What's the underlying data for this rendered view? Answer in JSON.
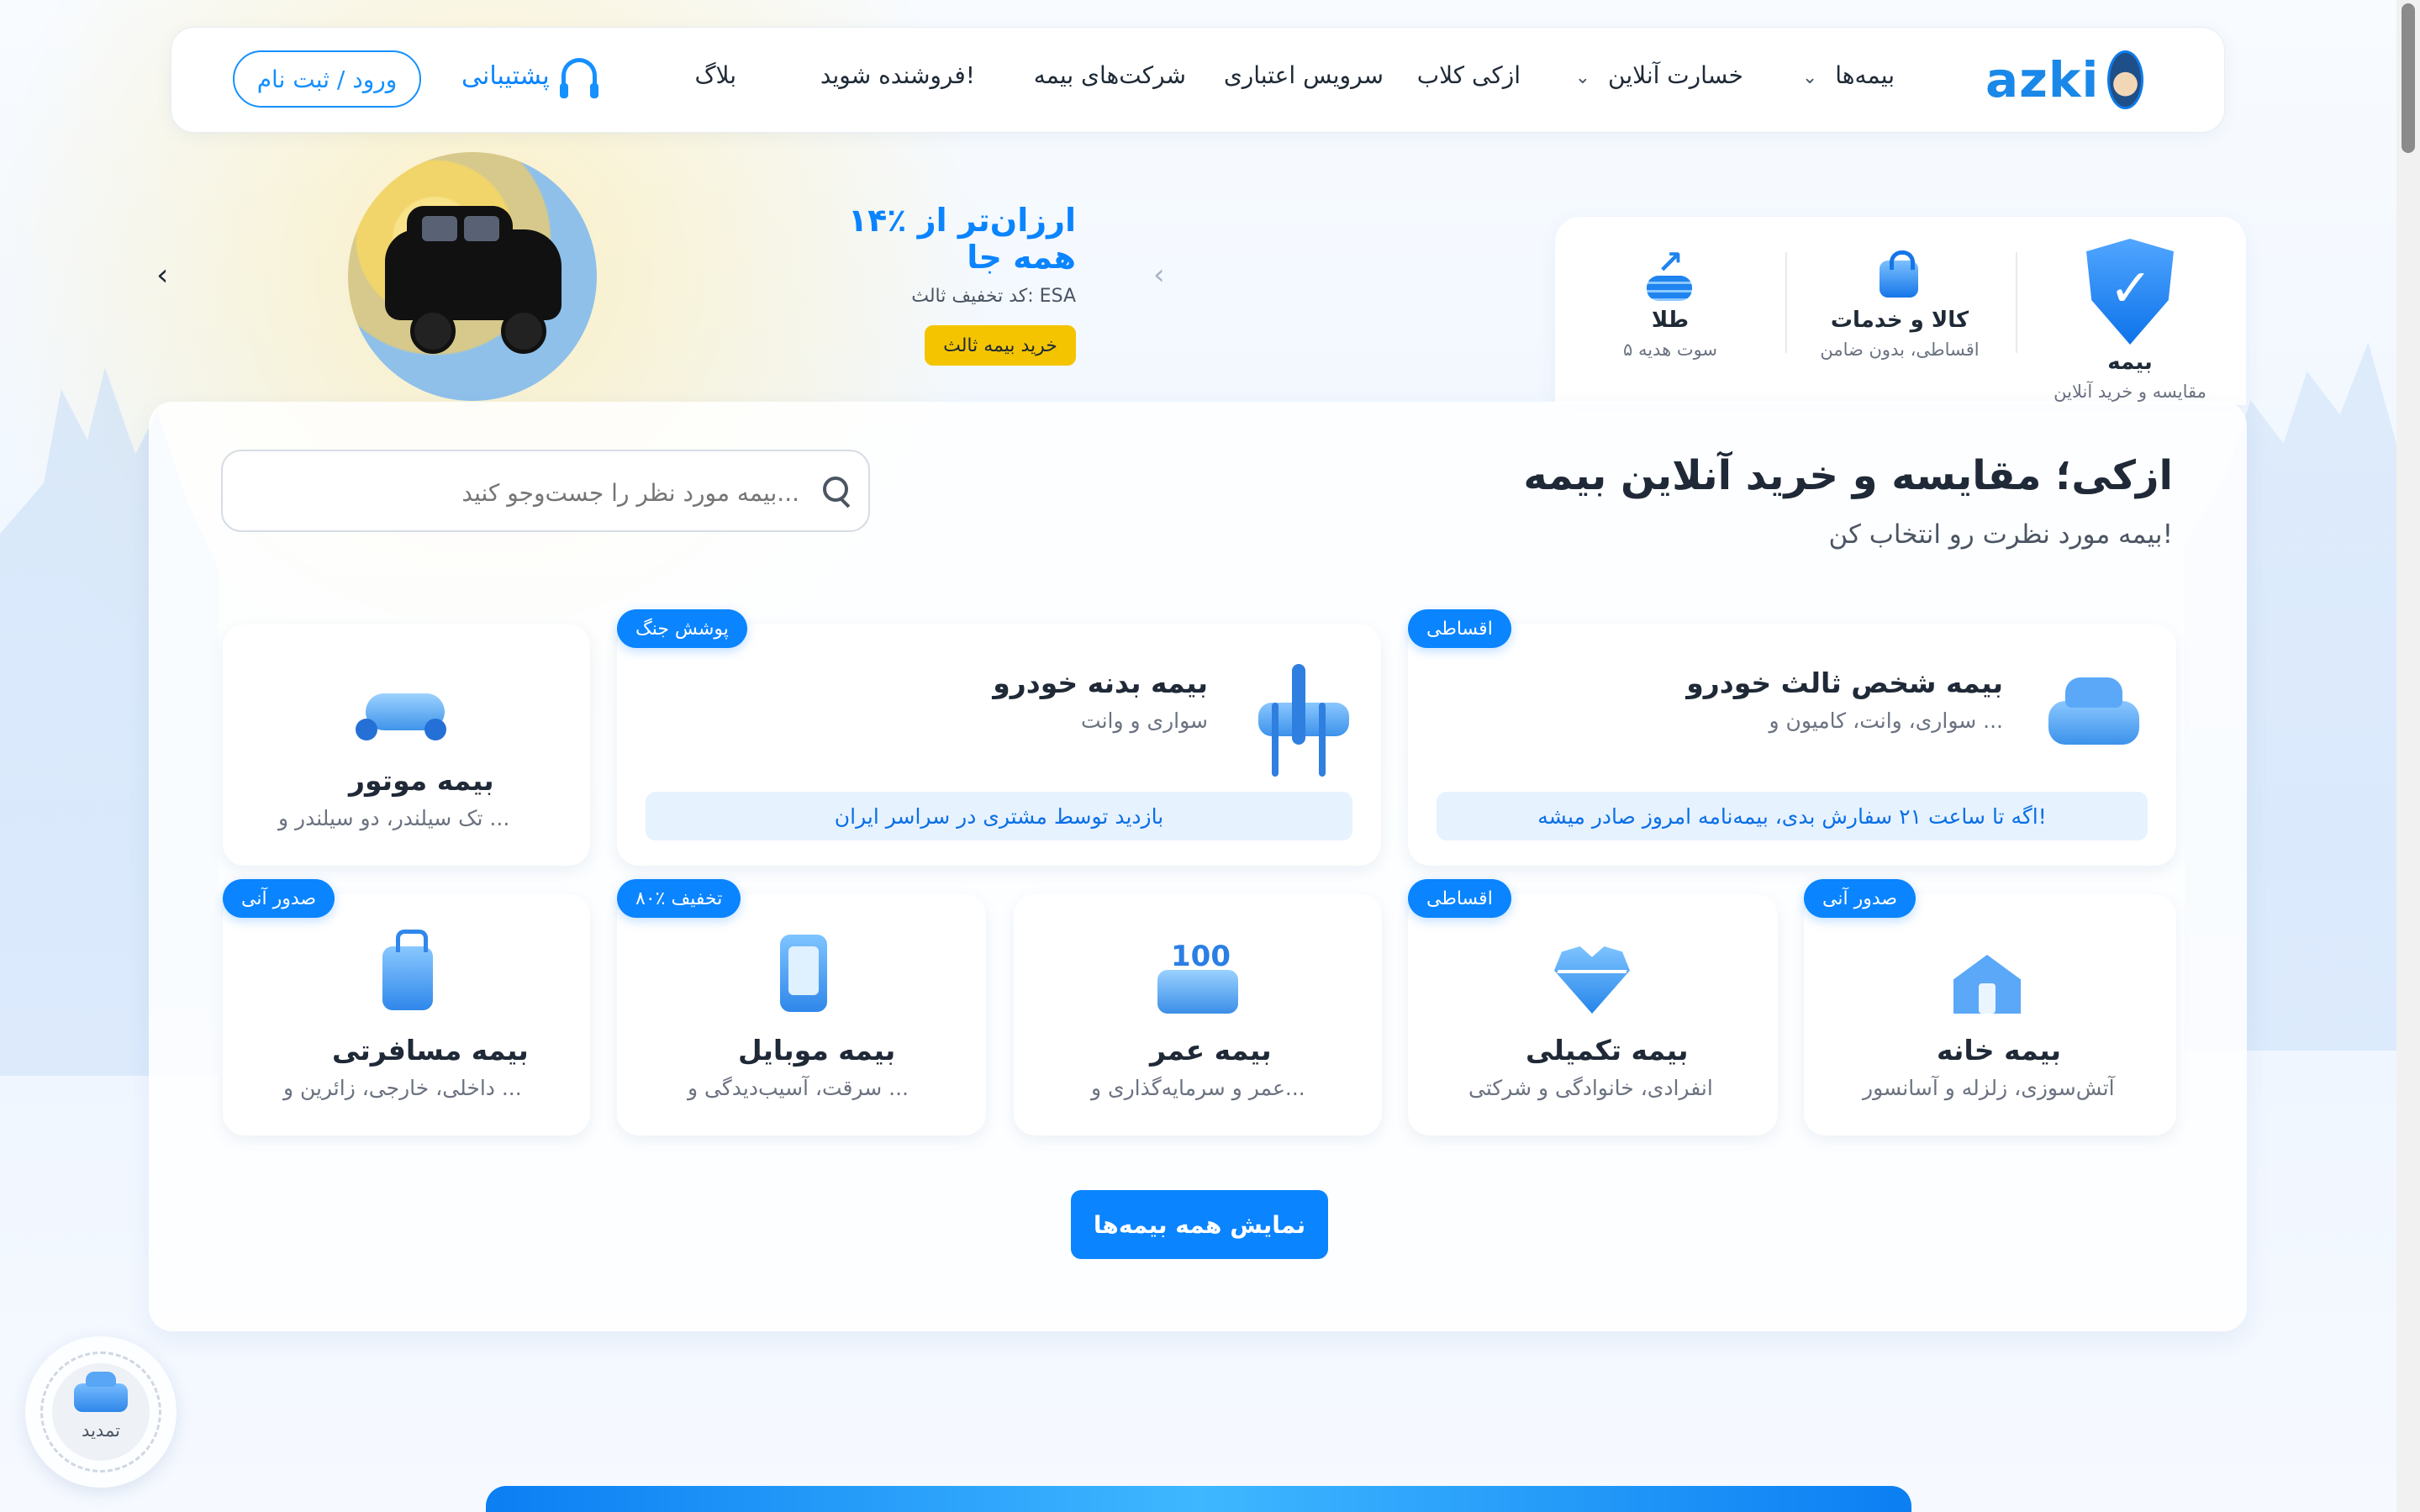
{
  "navbar": {
    "logo_text": "azki",
    "items": [
      {
        "label": "بیمه‌ها",
        "has_caret": true
      },
      {
        "label": "خسارت آنلاین",
        "has_caret": true
      },
      {
        "label": "ازکی کلاب",
        "has_caret": false
      },
      {
        "label": "سرویس اعتباری",
        "has_caret": false
      },
      {
        "label": "شرکت‌های بیمه",
        "has_caret": false
      },
      {
        "label": "فروشنده شوید!",
        "has_caret": false
      },
      {
        "label": "بلاگ",
        "has_caret": false
      }
    ],
    "support_label": "پشتیبانی",
    "login_label": "ورود / ثبت نام"
  },
  "top_categories": [
    {
      "title": "بیمه",
      "subtitle": "مقایسه و خرید آنلاین",
      "icon": "shield-check-icon"
    },
    {
      "title": "کالا و خدمات",
      "subtitle": "اقساطی، بدون ضامن",
      "icon": "shopping-bag-icon"
    },
    {
      "title": "طلا",
      "subtitle": "۵ سوت هدیه",
      "icon": "gold-growth-icon"
    }
  ],
  "promo": {
    "title": "۱۴٪ ارزان‌تر از همه جا",
    "code": "کد تخفیف ثالث: ESA",
    "button": "خرید بیمه ثالث"
  },
  "main": {
    "title": "ازکی؛ مقایسه و خرید آنلاین بیمه",
    "subtitle": "بیمه مورد نظرت رو انتخاب کن!",
    "search_placeholder": "بیمه مورد نظر را جست‌وجو کنید..."
  },
  "cards": {
    "third_party": {
      "badge": "اقساطی",
      "title": "بیمه شخص ثالث خودرو",
      "subtitle": "سواری، وانت، کامیون و ...",
      "note": "اگه تا ساعت ۲۱ سفارش بدی، بیمه‌نامه امروز صادر میشه!",
      "icon": "car-icon"
    },
    "body": {
      "badge": "پوشش جنگ",
      "title": "بیمه بدنه خودرو",
      "subtitle": "سواری و وانت",
      "note": "بازدید توسط مشتری در سراسر ایران",
      "icon": "car-lift-icon"
    },
    "motor": {
      "title": "بیمه موتور",
      "subtitle": "تک سیلندر، دو سیلندر و ...",
      "icon": "motorcycle-icon"
    },
    "house": {
      "badge": "صدور آنی",
      "title": "بیمه خانه",
      "subtitle": "آتش‌سوزی، زلزله و آسانسور",
      "icon": "house-icon"
    },
    "supplementary": {
      "badge": "اقساطی",
      "title": "بیمه تکمیلی",
      "subtitle": "انفرادی، خانوادگی و شرکتی",
      "icon": "heart-pulse-icon"
    },
    "life": {
      "title": "بیمه عمر",
      "subtitle": "عمر و سرمایه‌گذاری و...",
      "icon": "cake-icon"
    },
    "mobile": {
      "badge": "۸۰٪ تخفیف",
      "title": "بیمه موبایل",
      "subtitle": "سرقت، آسیب‌دیدگی و ...",
      "icon": "mobile-icon"
    },
    "travel": {
      "badge": "صدور آنی",
      "title": "بیمه مسافرتی",
      "subtitle": "داخلی، خارجی، زائرین و ...",
      "icon": "suitcase-icon"
    }
  },
  "show_all_label": "نمایش همه بیمه‌ها",
  "renew_label": "تمدید",
  "colors": {
    "primary": "#0a84ff",
    "accent_yellow": "#f4c400"
  }
}
